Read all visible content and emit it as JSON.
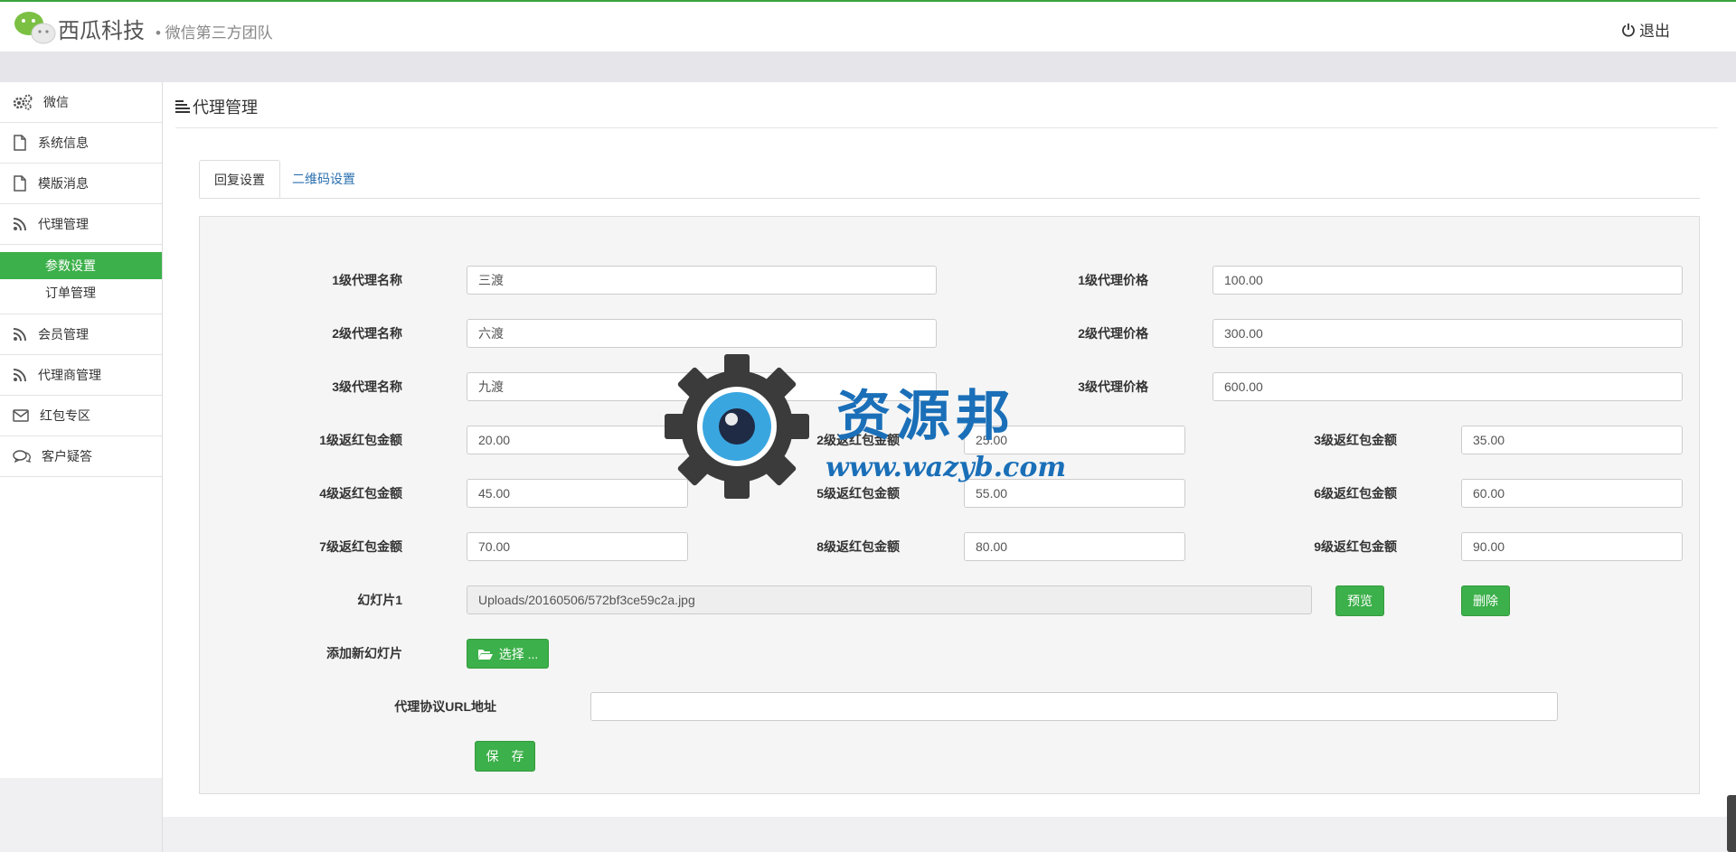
{
  "header": {
    "brand": "西瓜科技",
    "subtitle": "• 微信第三方团队",
    "logout_label": "退出"
  },
  "sidebar": {
    "items": [
      {
        "label": "微信",
        "icon": "gears-icon"
      },
      {
        "label": "系统信息",
        "icon": "file-icon"
      },
      {
        "label": "模版消息",
        "icon": "file-icon"
      },
      {
        "label": "代理管理",
        "icon": "rss-icon"
      }
    ],
    "sub_items": [
      {
        "label": "参数设置",
        "active": true
      },
      {
        "label": "订单管理",
        "active": false
      }
    ],
    "items_after": [
      {
        "label": "会员管理",
        "icon": "rss-icon"
      },
      {
        "label": "代理商管理",
        "icon": "rss-icon"
      },
      {
        "label": "红包专区",
        "icon": "envelope-icon"
      },
      {
        "label": "客户疑答",
        "icon": "comments-icon"
      }
    ]
  },
  "page": {
    "title": "代理管理"
  },
  "tabs": [
    {
      "label": "回复设置",
      "active": true
    },
    {
      "label": "二维码设置",
      "active": false
    }
  ],
  "form": {
    "agent_names": [
      {
        "label": "1级代理名称",
        "value": "三渡"
      },
      {
        "label": "2级代理名称",
        "value": "六渡"
      },
      {
        "label": "3级代理名称",
        "value": "九渡"
      }
    ],
    "agent_prices": [
      {
        "label": "1级代理价格",
        "value": "100.00"
      },
      {
        "label": "2级代理价格",
        "value": "300.00"
      },
      {
        "label": "3级代理价格",
        "value": "600.00"
      }
    ],
    "rebates": [
      {
        "label": "1级返红包金额",
        "value": "20.00"
      },
      {
        "label": "2级返红包金额",
        "value": "25.00"
      },
      {
        "label": "3级返红包金额",
        "value": "35.00"
      },
      {
        "label": "4级返红包金额",
        "value": "45.00"
      },
      {
        "label": "5级返红包金额",
        "value": "55.00"
      },
      {
        "label": "6级返红包金额",
        "value": "60.00"
      },
      {
        "label": "7级返红包金额",
        "value": "70.00"
      },
      {
        "label": "8级返红包金额",
        "value": "80.00"
      },
      {
        "label": "9级返红包金额",
        "value": "90.00"
      }
    ],
    "slide": {
      "label": "幻灯片1",
      "value": "Uploads/20160506/572bf3ce59c2a.jpg",
      "preview_label": "预览",
      "delete_label": "删除"
    },
    "add_slide": {
      "label": "添加新幻灯片",
      "button_label": "选择 ..."
    },
    "url": {
      "label": "代理协议URL地址",
      "value": ""
    },
    "save_label": "保　存"
  },
  "watermark": {
    "text": "资源邦",
    "url": "www.wazyb.com"
  },
  "colors": {
    "accent": "#3cb04a",
    "link": "#2a6fb0",
    "watermark": "#1a6fb8"
  }
}
